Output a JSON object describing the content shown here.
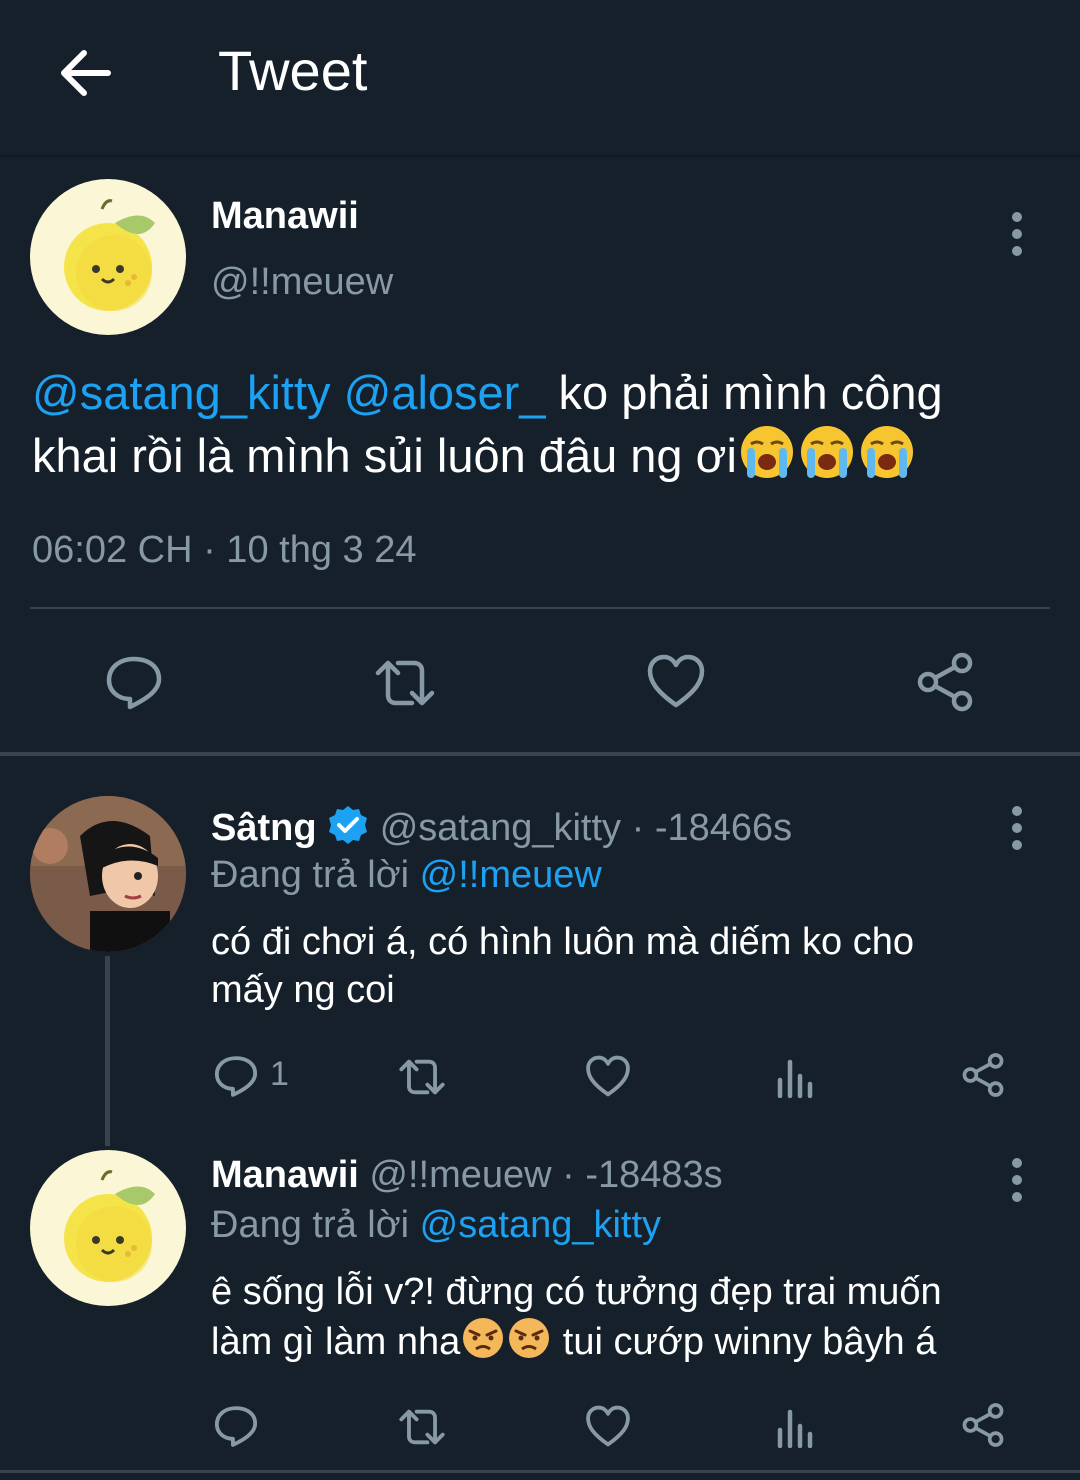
{
  "header": {
    "title": "Tweet",
    "back_icon": "arrow-left-icon"
  },
  "colors": {
    "background": "#15202b",
    "link": "#1da1f2",
    "muted": "#8899a6",
    "divider": "#38444d"
  },
  "main_tweet": {
    "name": "Manawii",
    "handle": "@!!meuew",
    "mention1": "@satang_kitty",
    "mention2": "@aloser_",
    "text_line1": "ko phải mình công",
    "text_line2": "khai rồi là mình sủi luôn đâu ng ơi",
    "emojis": [
      "loudly-crying-face",
      "loudly-crying-face",
      "loudly-crying-face"
    ],
    "timestamp": "06:02 CH · 10 thg 3 24",
    "actions": [
      "reply-icon",
      "retweet-icon",
      "like-icon",
      "share-icon"
    ]
  },
  "replies": [
    {
      "name": "Sâtng",
      "verified": true,
      "handle": "@satang_kitty",
      "time": "· -18466s",
      "replying_label": "Đang trả lời",
      "replying_to": "@!!meuew",
      "text_line1": "có đi chơi á, có hình luôn mà diếm ko cho",
      "text_line2": "mấy ng coi",
      "reply_count": "1",
      "actions": [
        "reply-icon",
        "retweet-icon",
        "like-icon",
        "analytics-icon",
        "share-icon"
      ]
    },
    {
      "name": "Manawii",
      "verified": false,
      "handle": "@!!meuew",
      "time": "· -18483s",
      "replying_label": "Đang trả lời",
      "replying_to": "@satang_kitty",
      "text_line1": "ê sống lỗi v?! đừng có tưởng đẹp trai muốn",
      "text_line2_a": "làm gì làm nha",
      "text_line2_b": "tui cướp winny bâyh á",
      "emojis": [
        "pouting-face",
        "pouting-face"
      ],
      "reply_count": "",
      "actions": [
        "reply-icon",
        "retweet-icon",
        "like-icon",
        "analytics-icon",
        "share-icon"
      ]
    }
  ]
}
